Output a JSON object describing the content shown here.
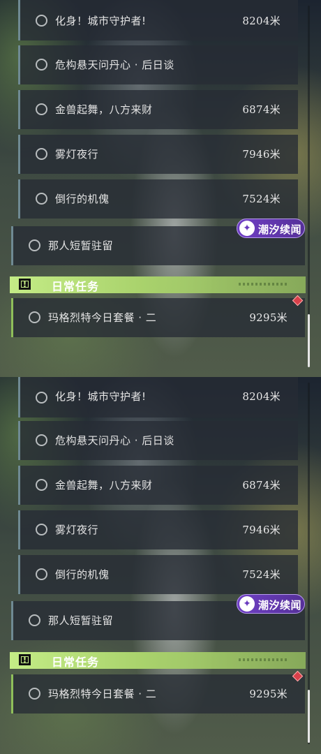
{
  "quest_list": {
    "rows": [
      {
        "title": "化身！城市守护者!",
        "distance": "8204米"
      },
      {
        "title": "危构悬天问丹心 · 后日谈",
        "distance": ""
      },
      {
        "title": "金兽起舞，八方来财",
        "distance": "6874米"
      },
      {
        "title": "雾灯夜行",
        "distance": "7946米"
      },
      {
        "title": "倒行的机傀",
        "distance": "7524米"
      },
      {
        "title": "那人短暂驻留",
        "distance": ""
      }
    ],
    "category_badge": "潮汐续闻",
    "daily_header": "日常任务",
    "daily_rows": [
      {
        "title": "玛格烈特今日套餐 · 二",
        "distance": "9295米"
      }
    ]
  },
  "colors": {
    "daily_accent": "#c4ec86",
    "badge": "#6f3fc4",
    "tracked_marker": "#d8404a"
  },
  "icons": {
    "row_status": "circle-outline-icon",
    "daily_header": "exclamation-box-icon",
    "badge": "tide-wave-icon",
    "tracked": "red-diamond-marker-icon"
  }
}
